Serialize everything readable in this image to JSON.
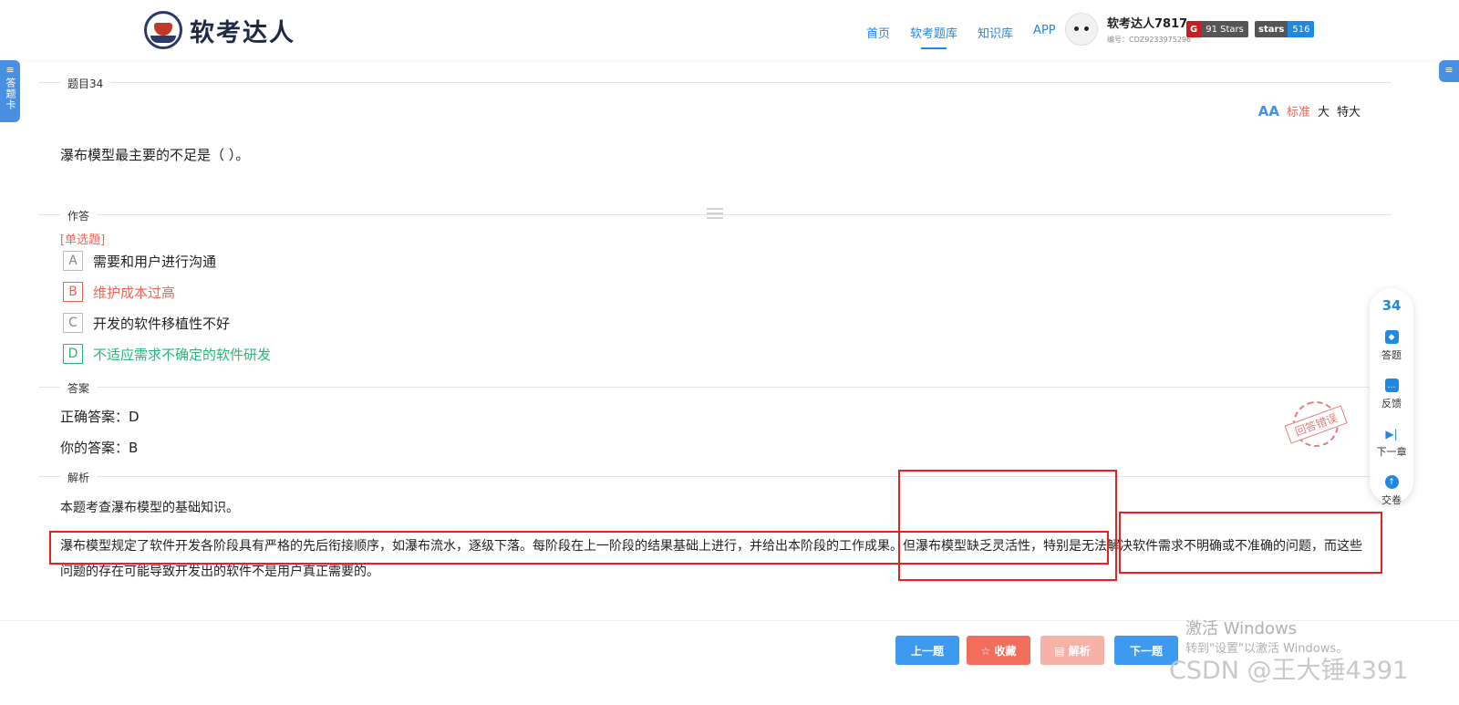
{
  "header": {
    "logo_text": "软考达人",
    "nav": [
      "首页",
      "软考题库",
      "知识库",
      "APP"
    ],
    "active_nav": "软考题库",
    "user_name": "软考达人7817",
    "user_id": "编号：CDZ9233975296",
    "badge1_left": "G",
    "badge1_right": "91 Stars",
    "badge2_left": "stars",
    "badge2_right": "516"
  },
  "sidebar": {
    "left_tab_icon": "≡",
    "left_tab": "答题卡",
    "right_tab_icon": "≡"
  },
  "question": {
    "section_label": "题目34",
    "font_sizes": [
      "标准",
      "大",
      "特大"
    ],
    "font_icon": "AA",
    "selected_font": "标准",
    "text": "瀑布模型最主要的不足是（   ）。"
  },
  "answer_area": {
    "section_label": "作答",
    "type": "[单选题]",
    "options": [
      {
        "key": "A",
        "text": "需要和用户进行沟通",
        "state": "normal"
      },
      {
        "key": "B",
        "text": "维护成本过高",
        "state": "wrong"
      },
      {
        "key": "C",
        "text": "开发的软件移植性不好",
        "state": "normal"
      },
      {
        "key": "D",
        "text": "不适应需求不确定的软件研发",
        "state": "right"
      }
    ]
  },
  "result": {
    "section_label": "答案",
    "correct": "正确答案：D",
    "yours": "你的答案：B",
    "stamp": "回答错误"
  },
  "analysis": {
    "section_label": "解析",
    "line1": "本题考查瀑布模型的基础知识。",
    "line2": "瀑布模型规定了软件开发各阶段具有严格的先后衔接顺序，如瀑布流水，逐级下落。每阶段在上一阶段的结果基础上进行，并给出本阶段的工作成果。但瀑布模型缺乏灵活性，特别是无法解决软件需求不明确或不准确的问题，而这些问题的存在可能导致开发出的软件不是用户真正需要的。"
  },
  "right_panel": {
    "number": "34",
    "items": [
      "答题",
      "反馈",
      "下一章",
      "交卷"
    ]
  },
  "buttons": {
    "prev": "上一题",
    "fav": "☆ 收藏",
    "analysis": "▤ 解析",
    "next": "下一题"
  },
  "overlay": {
    "activate_title": "激活 Windows",
    "activate_sub": "转到\"设置\"以激活 Windows。",
    "csdn": "CSDN @王大锤4391"
  },
  "colors": {
    "primary": "#1e88e5",
    "wrong": "#f0645a",
    "right": "#27b877",
    "annotation": "#e82020"
  }
}
